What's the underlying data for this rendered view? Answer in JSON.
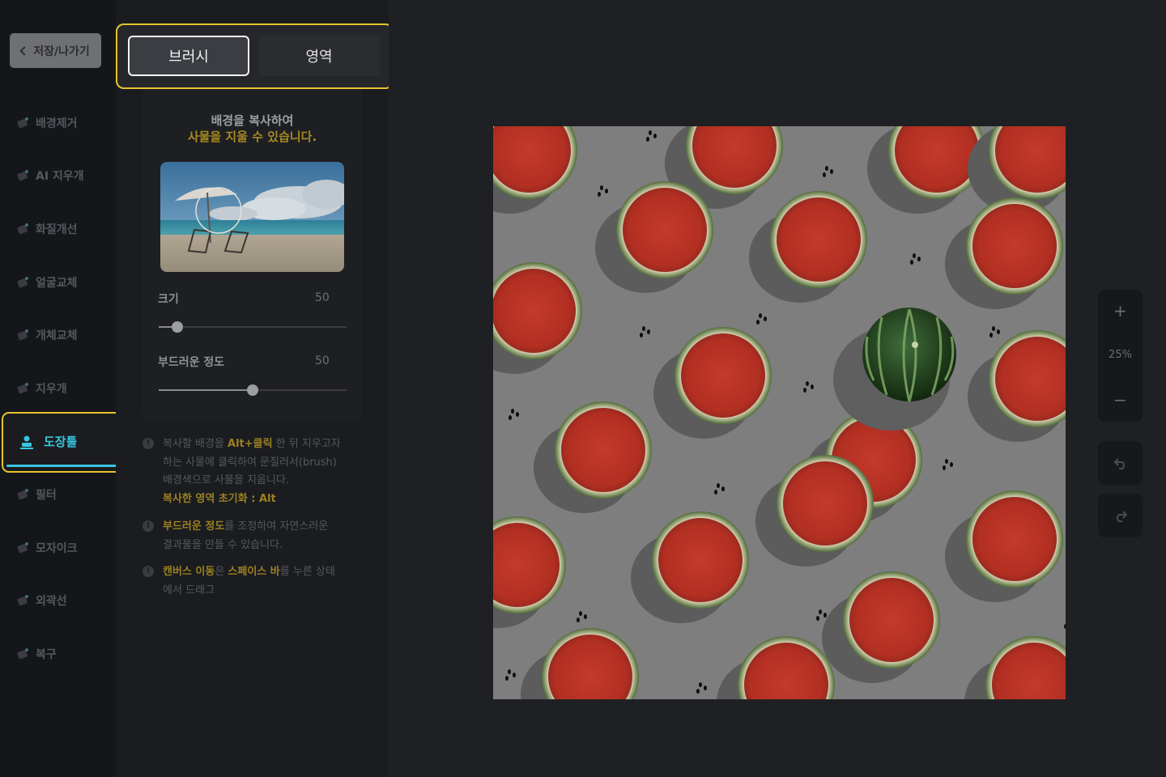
{
  "nav": {
    "back_label": "저장/나가기",
    "items": [
      {
        "label": "배경제거",
        "icon": "background-remove-icon"
      },
      {
        "label": "AI 지우개",
        "icon": "ai-eraser-icon"
      },
      {
        "label": "화질개선",
        "icon": "sparkle-icon"
      },
      {
        "label": "얼굴교체",
        "icon": "face-swap-icon"
      },
      {
        "label": "개체교체",
        "icon": "object-swap-icon"
      },
      {
        "label": "지우개",
        "icon": "eraser-icon"
      },
      {
        "label": "도장툴",
        "icon": "stamp-icon"
      },
      {
        "label": "필터",
        "icon": "filter-icon"
      },
      {
        "label": "모자이크",
        "icon": "mosaic-icon"
      },
      {
        "label": "외곽선",
        "icon": "outline-icon"
      },
      {
        "label": "복구",
        "icon": "restore-icon"
      }
    ],
    "active": "도장툴"
  },
  "panel": {
    "tabs": [
      {
        "label": "브러시"
      },
      {
        "label": "영역"
      }
    ],
    "active_tab": "브러시",
    "title_line1": "배경을 복사하여",
    "title_line2": "사물을 지울 수 있습니다.",
    "sliders": [
      {
        "label": "크기",
        "value": "50",
        "fraction": 0.1
      },
      {
        "label": "부드러운 정도",
        "value": "50",
        "fraction": 0.5
      }
    ],
    "tips": [
      {
        "lines": [
          [
            {
              "t": "복사할 배경을 "
            },
            {
              "t": "Alt+클릭",
              "hl": true
            },
            {
              "t": " 한 뒤 지우고자"
            }
          ],
          [
            {
              "t": "하는 사물에 클릭하여 문질러서(brush)"
            }
          ],
          [
            {
              "t": "배경색으로 사물을 지웁니다."
            }
          ],
          [
            {
              "t": "복사한 영역 초기화 : Alt",
              "hl": true
            }
          ]
        ]
      },
      {
        "lines": [
          [
            {
              "t": "부드러운 정도",
              "hl": true
            },
            {
              "t": "를 조정하여 자연스러운"
            }
          ],
          [
            {
              "t": "결과물을 만들 수 있습니다."
            }
          ]
        ]
      },
      {
        "lines": [
          [
            {
              "t": "캔버스 이동",
              "hl": true
            },
            {
              "t": "은 "
            },
            {
              "t": "스페이스 바",
              "hl": true
            },
            {
              "t": "를 누른 상태"
            }
          ],
          [
            {
              "t": "에서 드래그"
            }
          ]
        ]
      }
    ]
  },
  "canvas": {
    "zoom_level": "25%",
    "zoom_in": "+",
    "zoom_out": "−"
  },
  "colors": {
    "accent": "#38c7e0",
    "highlight": "#e6c42e",
    "tip_highlight": "#9c8120"
  }
}
